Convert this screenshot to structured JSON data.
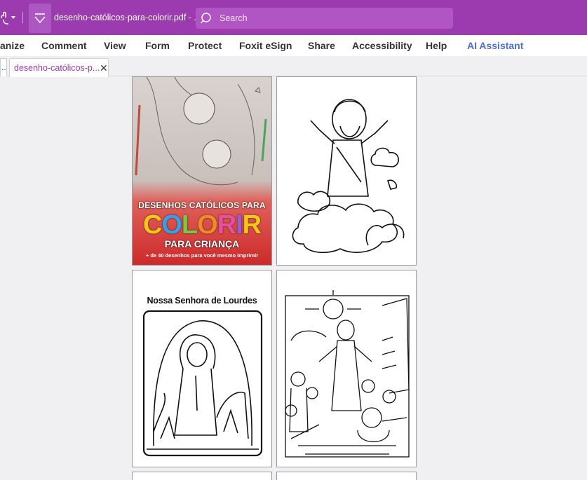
{
  "titlebar": {
    "document_title": "desenho-católicos-para-colorir.pdf - ...",
    "search_placeholder": "Search",
    "background_color": "#9c3bb0"
  },
  "menu": {
    "items": [
      "anize",
      "Comment",
      "View",
      "Form",
      "Protect",
      "Foxit eSign",
      "Share",
      "Accessibility",
      "Help",
      "AI Assistant"
    ],
    "ai_color": "#4f6fd6"
  },
  "tabs": {
    "previous_label": "..",
    "active_label": "desenho-católicos-p...",
    "close_glyph": "✕"
  },
  "pages": {
    "cover": {
      "title": "DESENHOS CATÓLICOS PARA",
      "colorir_letters": [
        "C",
        "O",
        "L",
        "O",
        "R",
        "I",
        "R"
      ],
      "colorir_colors": [
        "#f5c518",
        "#3a9ee6",
        "#7ac943",
        "#f08a24",
        "#e84f9c",
        "#9c5cd6",
        "#f5c518"
      ],
      "subtitle": "PARA CRIANÇA",
      "tagline": "+ de 40 desenhos para você mesmo imprimir"
    },
    "lourdes": {
      "title": "Nossa Senhora de Lourdes"
    }
  }
}
